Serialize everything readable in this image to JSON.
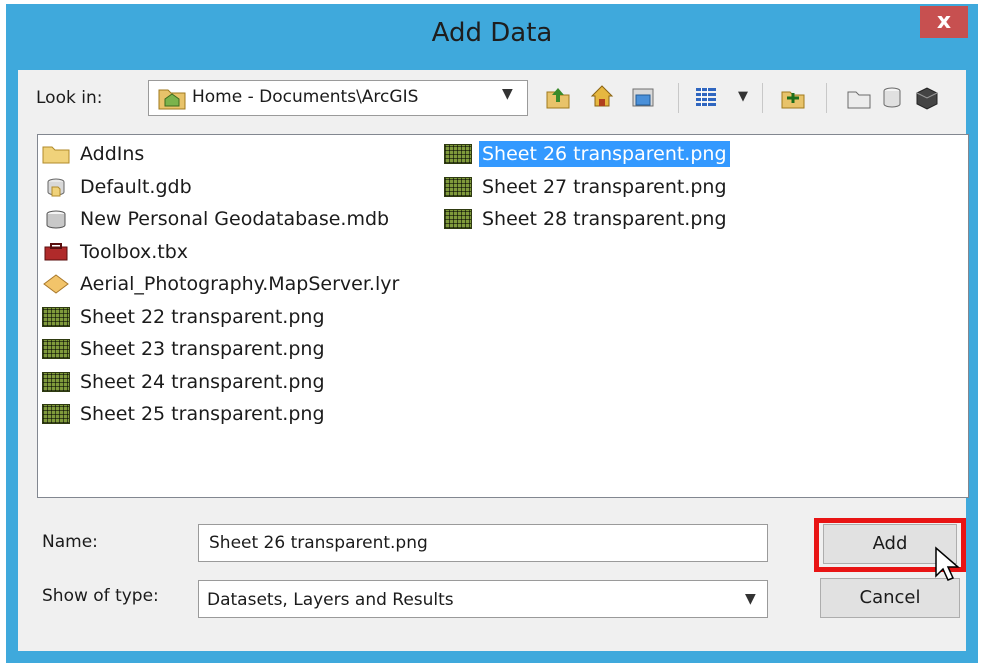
{
  "window": {
    "title": "Add Data",
    "close_label": "x"
  },
  "lookin": {
    "label": "Look in:",
    "value": "Home - Documents\\ArcGIS"
  },
  "toolbar": {
    "icons": [
      "up-folder-icon",
      "home-icon",
      "catalog-icon",
      "view-list-icon",
      "new-folder-icon",
      "connect-folder-icon",
      "new-file-geodatabase-icon",
      "toolbox-icon"
    ]
  },
  "files": {
    "col1": [
      {
        "name": "AddIns",
        "icon": "folder-icon"
      },
      {
        "name": "Default.gdb",
        "icon": "file-geodatabase-icon"
      },
      {
        "name": "New Personal Geodatabase.mdb",
        "icon": "personal-geodatabase-icon"
      },
      {
        "name": "Toolbox.tbx",
        "icon": "toolbox-icon"
      },
      {
        "name": "Aerial_Photography.MapServer.lyr",
        "icon": "layer-file-icon"
      },
      {
        "name": "Sheet 22 transparent.png",
        "icon": "raster-icon"
      },
      {
        "name": "Sheet 23 transparent.png",
        "icon": "raster-icon"
      },
      {
        "name": "Sheet 24 transparent.png",
        "icon": "raster-icon"
      },
      {
        "name": "Sheet 25 transparent.png",
        "icon": "raster-icon"
      }
    ],
    "col2": [
      {
        "name": "Sheet 26 transparent.png",
        "icon": "raster-icon",
        "selected": true
      },
      {
        "name": "Sheet 27 transparent.png",
        "icon": "raster-icon"
      },
      {
        "name": "Sheet 28 transparent.png",
        "icon": "raster-icon"
      }
    ]
  },
  "name_field": {
    "label": "Name:",
    "value": "Sheet 26 transparent.png"
  },
  "type_field": {
    "label": "Show of type:",
    "value": "Datasets, Layers and Results"
  },
  "buttons": {
    "add": "Add",
    "cancel": "Cancel"
  },
  "colors": {
    "titlebar": "#3fa9dc",
    "selection": "#3399ff",
    "highlight": "#e81414",
    "close": "#c75050"
  }
}
